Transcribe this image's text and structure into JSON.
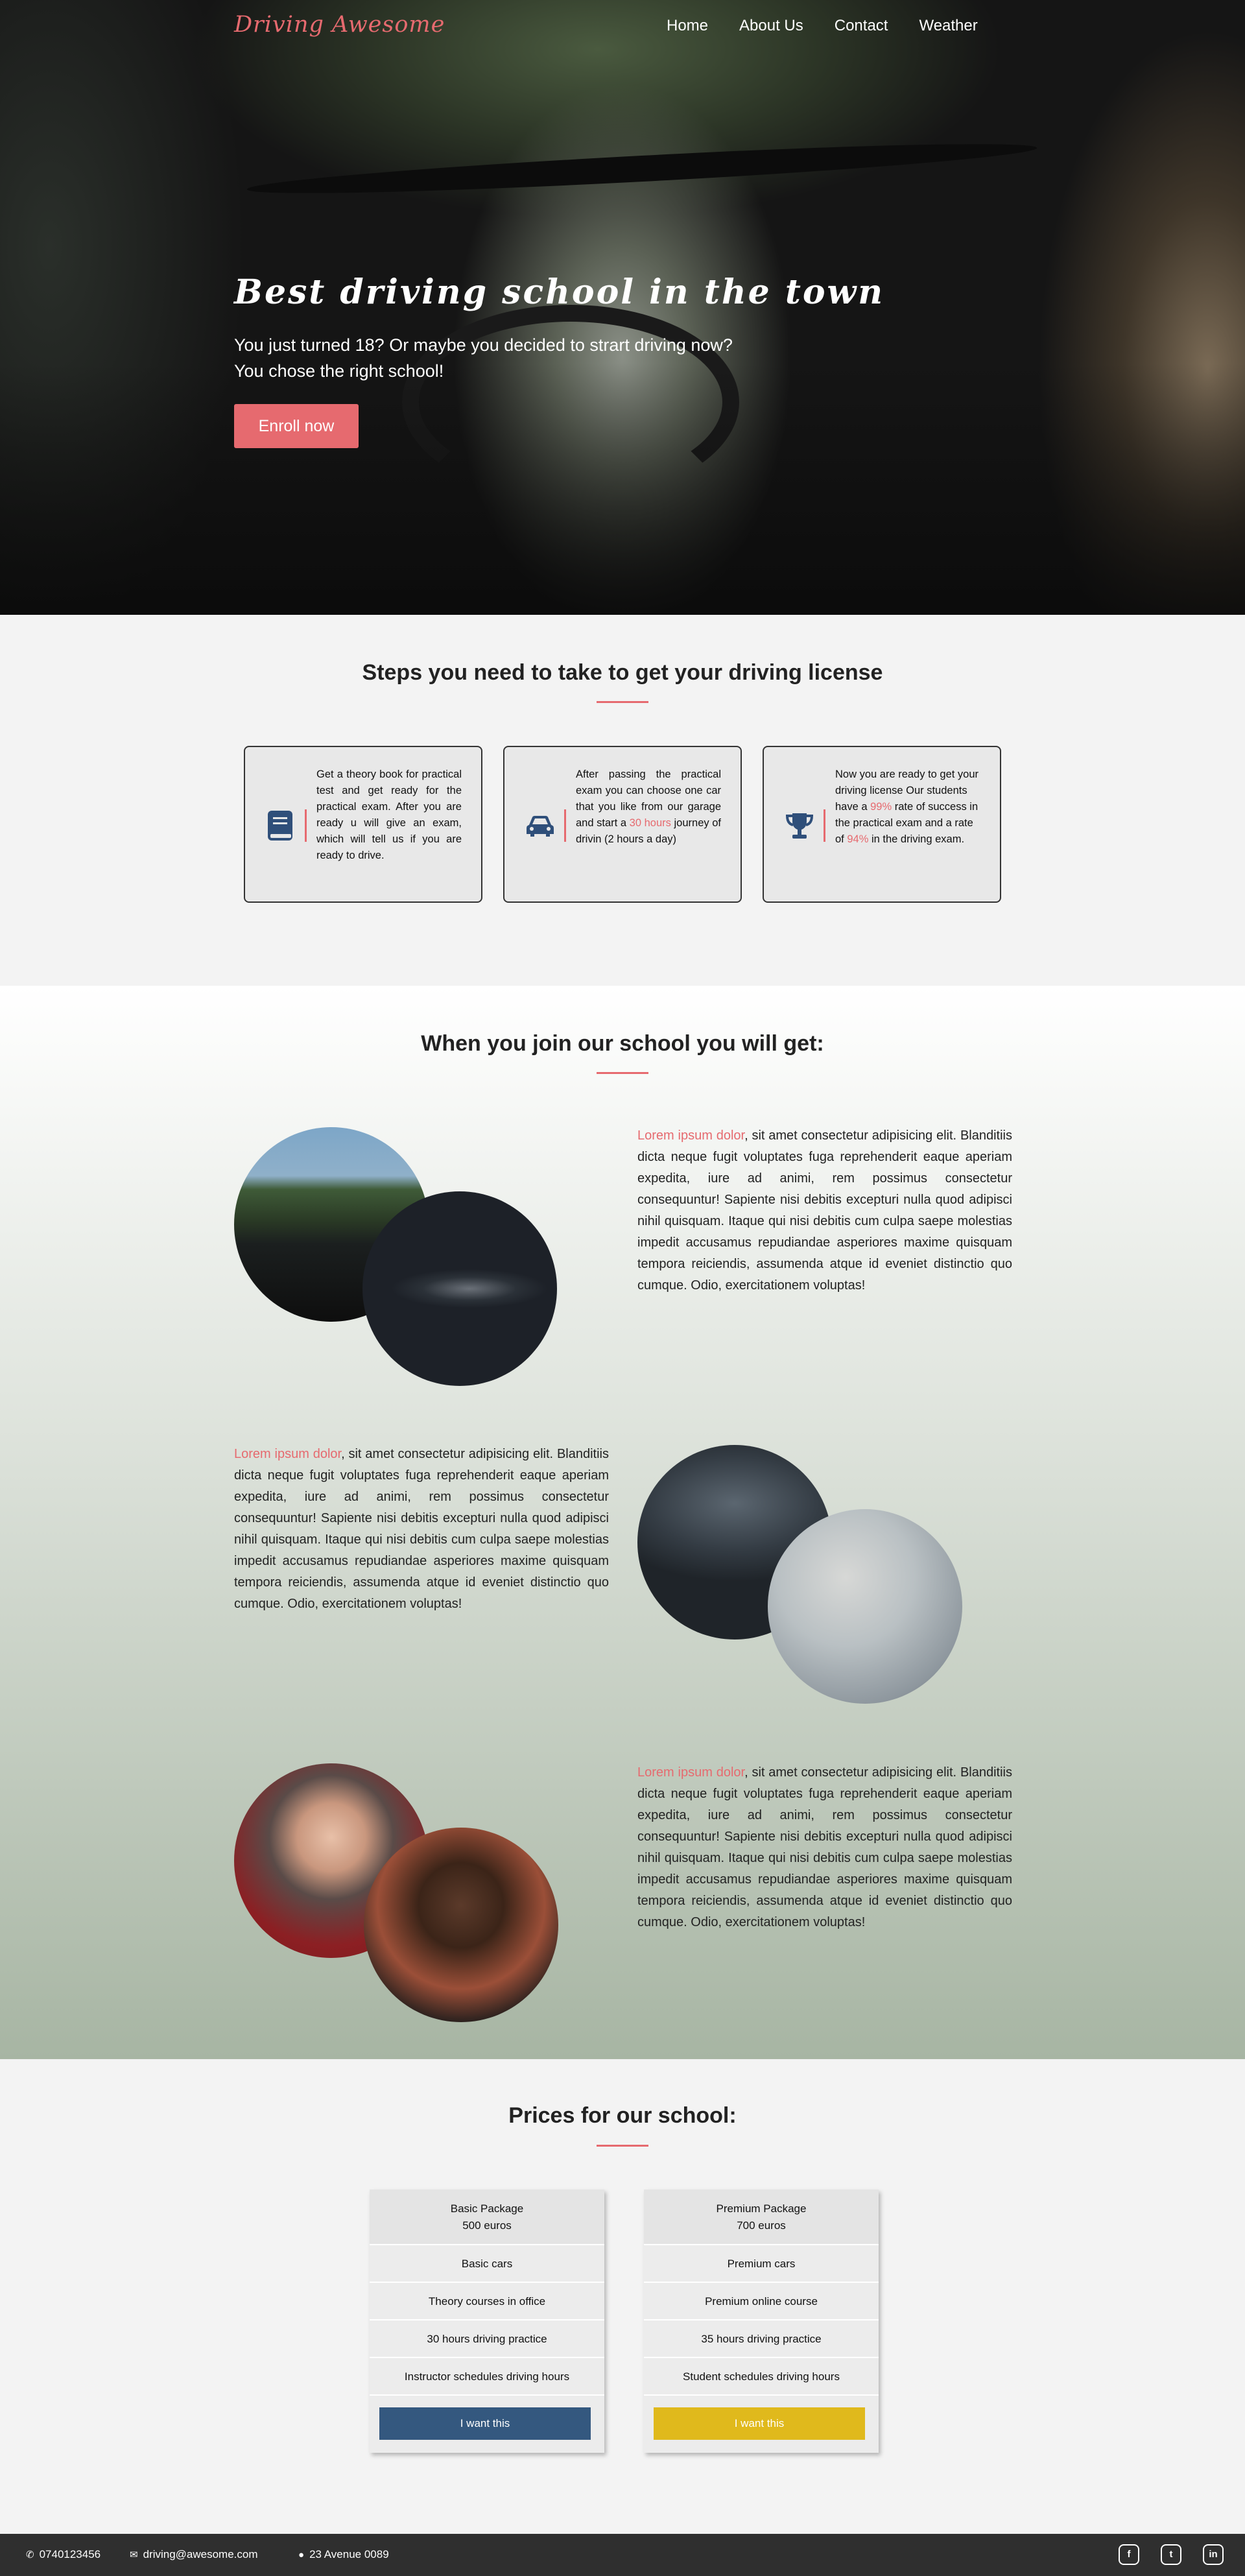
{
  "brand": "Driving Awesome",
  "nav": {
    "items": [
      "Home",
      "About Us",
      "Contact",
      "Weather"
    ]
  },
  "hero": {
    "title": "Best driving school in the town",
    "subtitle_line1": "You just turned 18? Or maybe you decided to strart driving now?",
    "subtitle_line2": "You chose the right school!",
    "cta": "Enroll now"
  },
  "steps": {
    "title": "Steps you need to take to get your driving license",
    "cards": [
      {
        "icon": "book-icon",
        "text": "Get a theory book for practical test and get ready for the practical exam. After you are ready u will give an exam, which will tell us if you are ready to drive."
      },
      {
        "icon": "car-icon",
        "text_before": "After passing the practical exam you can choose one car that you like from our garage and start a ",
        "highlight": "30 hours",
        "text_after": " journey of drivin (2 hours a day)"
      },
      {
        "icon": "trophy-icon",
        "text_before": "Now you are ready to get your driving license Our students have a ",
        "highlight1": "99%",
        "text_mid": " rate of success in the practical exam and a rate of ",
        "highlight2": "94%",
        "text_after": " in the driving exam."
      }
    ]
  },
  "benefits": {
    "title": "When you join our school you will get:",
    "lead": "Lorem ipsum dolor",
    "body": ", sit amet consectetur adipisicing elit. Blanditiis dicta neque fugit voluptates fuga reprehenderit eaque aperiam expedita, iure ad animi, rem possimus consectetur consequuntur! Sapiente nisi debitis excepturi nulla quod adipisci nihil quisquam. Itaque qui nisi debitis cum culpa saepe molestias impedit accusamus repudiandae asperiores maxime quisquam tempora reiciendis, assumenda atque id eveniet distinctio quo cumque. Odio, exercitationem voluptas!"
  },
  "prices": {
    "title": "Prices for our school:",
    "packages": [
      {
        "name": "Basic Package",
        "price": "500 euros",
        "features": [
          "Basic cars",
          "Theory courses in office",
          "30 hours driving practice",
          "Instructor schedules driving hours"
        ],
        "button": "I want this",
        "color": "#34587f"
      },
      {
        "name": "Premium Package",
        "price": "700 euros",
        "features": [
          "Premium cars",
          "Premium online course",
          "35 hours driving practice",
          "Student schedules driving hours"
        ],
        "button": "I want this",
        "color": "#e0b91c"
      }
    ]
  },
  "footer": {
    "phone": "0740123456",
    "email": "driving@awesome.com",
    "address": "23 Avenue 0089",
    "social": [
      "facebook-icon",
      "twitter-icon",
      "linkedin-icon"
    ]
  },
  "colors": {
    "accent": "#e66a6f",
    "navy": "#34587f",
    "gold": "#e0b91c",
    "footer": "#2f2f2f"
  }
}
